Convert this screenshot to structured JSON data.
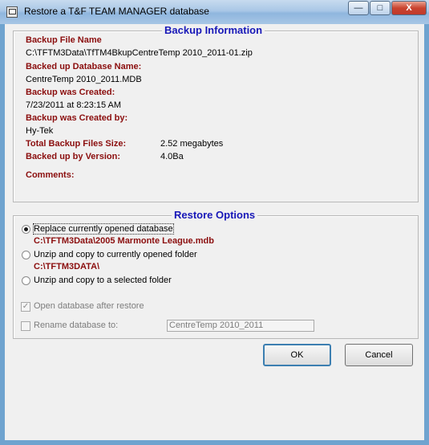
{
  "window": {
    "title": "Restore a T&F TEAM MANAGER database"
  },
  "title_buttons": {
    "minimize": "—",
    "maximize": "□",
    "close": "X"
  },
  "backup_info": {
    "heading": "Backup Information",
    "file_name_label": "Backup File Name",
    "file_name_value": "C:\\TFTM3Data\\TfTM4BkupCentreTemp 2010_2011-01.zip",
    "db_name_label": "Backed up Database Name:",
    "db_name_value": "CentreTemp 2010_2011.MDB",
    "created_label": "Backup was Created:",
    "created_value": "7/23/2011 at 8:23:15 AM",
    "created_by_label": "Backup was Created by:",
    "created_by_value": "Hy-Tek",
    "size_label": "Total Backup Files Size:",
    "size_value": "2.52 megabytes",
    "version_label": "Backed up by Version:",
    "version_value": "4.0Ba",
    "comments_label": "Comments:"
  },
  "restore_options": {
    "heading": "Restore Options",
    "options": [
      {
        "label": "Replace currently opened database",
        "path": "C:\\TFTM3Data\\2005 Marmonte League.mdb",
        "selected": true
      },
      {
        "label": "Unzip and copy to currently opened folder",
        "path": "C:\\TFTM3DATA\\",
        "selected": false
      },
      {
        "label": "Unzip and copy to a selected folder",
        "selected": false
      }
    ],
    "open_after_label": "Open database after restore",
    "open_after_checked": true,
    "rename_label": "Rename database to:",
    "rename_checked": false,
    "rename_value": "CentreTemp 2010_2011"
  },
  "buttons": {
    "ok": "OK",
    "cancel": "Cancel"
  }
}
